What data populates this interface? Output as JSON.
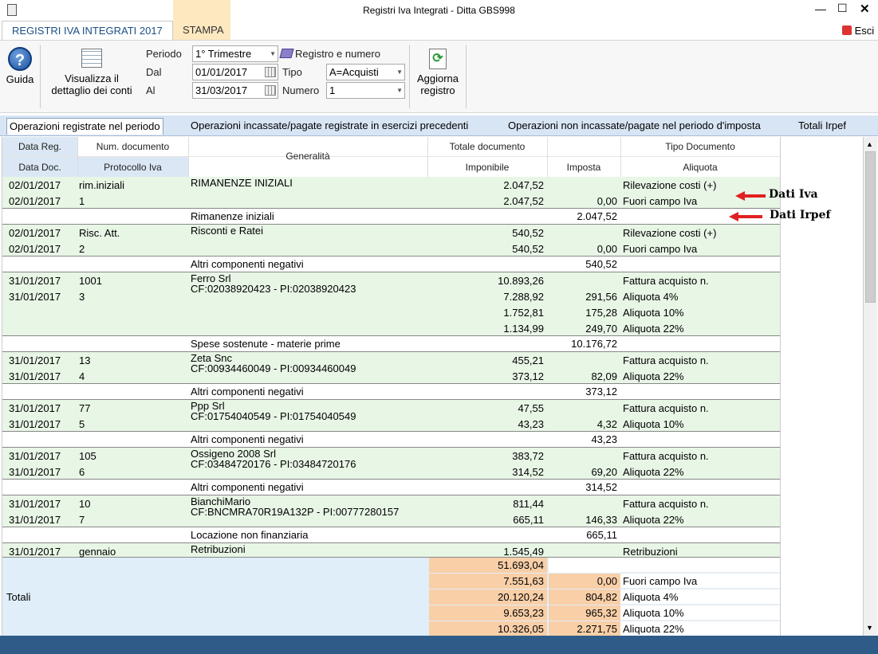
{
  "window": {
    "title": "Registri Iva Integrati - Ditta GBS998",
    "min": "—",
    "max": "☐",
    "close": "✕"
  },
  "ribbon_tabs": [
    "REGISTRI IVA INTEGRATI 2017",
    "STAMPA"
  ],
  "esci": "Esci",
  "toolbar": {
    "guida": "Guida",
    "visualizza": [
      "Visualizza il",
      "dettaglio dei conti"
    ],
    "periodo_label": "Periodo",
    "periodo_value": "1° Trimestre",
    "dal_label": "Dal",
    "dal_value": "01/01/2017",
    "al_label": "Al",
    "al_value": "31/03/2017",
    "registro_label": "Registro e numero",
    "tipo_label": "Tipo",
    "tipo_value": "A=Acquisti",
    "numero_label": "Numero",
    "numero_value": "1",
    "aggiorna": [
      "Aggiorna",
      "registro"
    ]
  },
  "view_tabs": [
    "Operazioni registrate nel periodo",
    "Operazioni incassate/pagate registrate in esercizi precedenti",
    "Operazioni non incassate/pagate nel periodo d'imposta",
    "Totali Irpef"
  ],
  "headers": {
    "row1": [
      "Data Reg.",
      "Num. documento",
      "Generalità",
      "Totale documento",
      "",
      "Tipo Documento"
    ],
    "row2": [
      "Data Doc.",
      "Protocollo Iva",
      "",
      "Imponibile",
      "Imposta",
      "Aliquota"
    ]
  },
  "rows": [
    {
      "kind": "g",
      "h": 40,
      "c1": [
        "02/01/2017",
        "02/01/2017"
      ],
      "c2": [
        "rim.iniziali",
        "1"
      ],
      "gen": [
        "RIMANENZE INIZIALI"
      ],
      "imp": [
        "2.047,52",
        "2.047,52"
      ],
      "iva": [
        "",
        "0,00"
      ],
      "ali": [
        "Rilevazione costi (+)",
        "Fuori campo Iva"
      ]
    },
    {
      "kind": "s",
      "h": 20,
      "label": "Rimanenze iniziali",
      "val": "2.047,52"
    },
    {
      "kind": "g",
      "h": 40,
      "c1": [
        "02/01/2017",
        "02/01/2017"
      ],
      "c2": [
        "Risc. Att.",
        "2"
      ],
      "gen": [
        "Risconti e Ratei"
      ],
      "imp": [
        "540,52",
        "540,52"
      ],
      "iva": [
        "",
        "0,00"
      ],
      "ali": [
        "Rilevazione costi (+)",
        "Fuori campo Iva"
      ]
    },
    {
      "kind": "s",
      "h": 20,
      "label": "Altri componenti negativi",
      "val": "540,52"
    },
    {
      "kind": "g",
      "h": 80,
      "c1": [
        "31/01/2017",
        "31/01/2017"
      ],
      "c2": [
        "1001",
        "3"
      ],
      "gen": [
        "Ferro Srl",
        "CF:02038920423 - PI:02038920423"
      ],
      "imp": [
        "10.893,26",
        "7.288,92",
        "1.752,81",
        "1.134,99"
      ],
      "iva": [
        "",
        "291,56",
        "175,28",
        "249,70"
      ],
      "ali": [
        "Fattura acquisto n.",
        "Aliquota 4%",
        "Aliquota 10%",
        "Aliquota 22%"
      ]
    },
    {
      "kind": "s",
      "h": 20,
      "label": "Spese sostenute - materie prime",
      "val": "10.176,72"
    },
    {
      "kind": "g",
      "h": 40,
      "c1": [
        "31/01/2017",
        "31/01/2017"
      ],
      "c2": [
        "13",
        "4"
      ],
      "gen": [
        "Zeta Snc",
        "CF:00934460049 - PI:00934460049"
      ],
      "imp": [
        "455,21",
        "373,12"
      ],
      "iva": [
        "",
        "82,09"
      ],
      "ali": [
        "Fattura acquisto n.",
        "Aliquota 22%"
      ]
    },
    {
      "kind": "s",
      "h": 20,
      "label": "Altri componenti negativi",
      "val": "373,12"
    },
    {
      "kind": "g",
      "h": 40,
      "c1": [
        "31/01/2017",
        "31/01/2017"
      ],
      "c2": [
        "77",
        "5"
      ],
      "gen": [
        "Ppp Srl",
        "CF:01754040549 - PI:01754040549"
      ],
      "imp": [
        "47,55",
        "43,23"
      ],
      "iva": [
        "",
        "4,32"
      ],
      "ali": [
        "Fattura acquisto n.",
        "Aliquota 10%"
      ]
    },
    {
      "kind": "s",
      "h": 20,
      "label": "Altri componenti negativi",
      "val": "43,23"
    },
    {
      "kind": "g",
      "h": 40,
      "c1": [
        "31/01/2017",
        "31/01/2017"
      ],
      "c2": [
        "105",
        "6"
      ],
      "gen": [
        "Ossigeno 2008 Srl",
        "CF:03484720176 - PI:03484720176"
      ],
      "imp": [
        "383,72",
        "314,52"
      ],
      "iva": [
        "",
        "69,20"
      ],
      "ali": [
        "Fattura acquisto n.",
        "Aliquota 22%"
      ]
    },
    {
      "kind": "s",
      "h": 20,
      "label": "Altri componenti negativi",
      "val": "314,52"
    },
    {
      "kind": "g",
      "h": 40,
      "c1": [
        "31/01/2017",
        "31/01/2017"
      ],
      "c2": [
        "10",
        "7"
      ],
      "gen": [
        "BianchiMario",
        "CF:BNCMRA70R19A132P - PI:00777280157"
      ],
      "imp": [
        "811,44",
        "665,11"
      ],
      "iva": [
        "",
        "146,33"
      ],
      "ali": [
        "Fattura acquisto n.",
        "Aliquota 22%"
      ]
    },
    {
      "kind": "s",
      "h": 20,
      "label": "Locazione non finanziaria",
      "val": "665,11"
    },
    {
      "kind": "g",
      "h": 18,
      "c1": [
        "31/01/2017"
      ],
      "c2": [
        "gennaio"
      ],
      "gen": [
        "Retribuzioni"
      ],
      "imp": [
        "1.545,49"
      ],
      "iva": [
        ""
      ],
      "ali": [
        "Retribuzioni"
      ]
    }
  ],
  "totals": {
    "label": "Totali",
    "lines": [
      [
        "51.693,04",
        "",
        ""
      ],
      [
        "7.551,63",
        "0,00",
        "Fuori campo Iva"
      ],
      [
        "20.120,24",
        "804,82",
        "Aliquota 4%"
      ],
      [
        "9.653,23",
        "965,32",
        "Aliquota 10%"
      ],
      [
        "10.326,05",
        "2.271,75",
        "Aliquota 22%"
      ]
    ]
  },
  "annotations": [
    "Dati Iva",
    "Dati Irpef"
  ]
}
